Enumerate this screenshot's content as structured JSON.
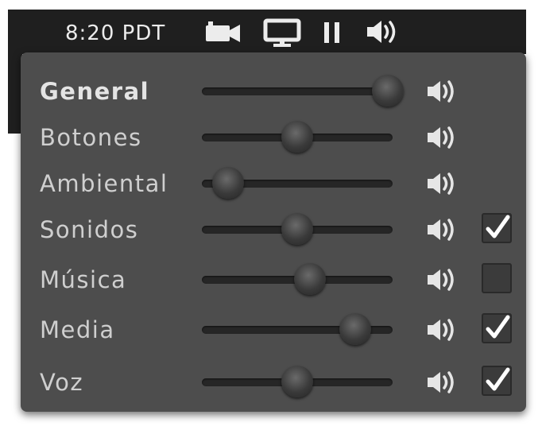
{
  "topbar": {
    "clock": "8:20 PDT",
    "icons": [
      "camera-icon",
      "monitor-icon",
      "pause-icon",
      "speaker-icon"
    ]
  },
  "volume_panel": {
    "rows": [
      {
        "label": "General",
        "level": 1.0,
        "bold": true,
        "checkbox": null
      },
      {
        "label": "Botones",
        "level": 0.5,
        "bold": false,
        "checkbox": null
      },
      {
        "label": "Ambiental",
        "level": 0.12,
        "bold": false,
        "checkbox": null
      },
      {
        "label": "Sonidos",
        "level": 0.5,
        "bold": false,
        "checkbox": true
      },
      {
        "label": "Música",
        "level": 0.57,
        "bold": false,
        "checkbox": false
      },
      {
        "label": "Media",
        "level": 0.82,
        "bold": false,
        "checkbox": true
      },
      {
        "label": "Voz",
        "level": 0.5,
        "bold": false,
        "checkbox": true
      }
    ]
  },
  "colors": {
    "topbar_bg": "#1f1f1f",
    "panel_bg": "#4d4d4d",
    "text": "#cfcfcf"
  }
}
